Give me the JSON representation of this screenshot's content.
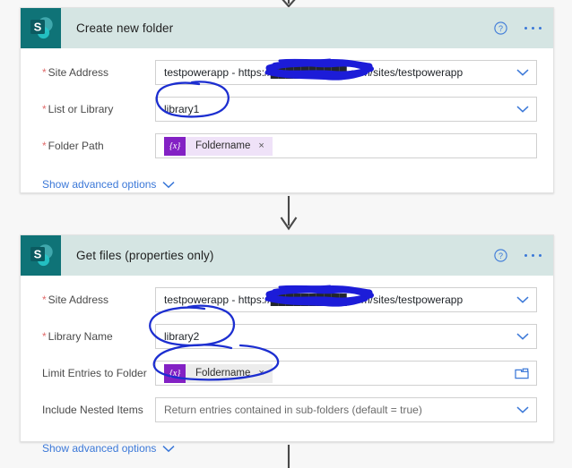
{
  "page": {
    "background": "#f7f7f7",
    "accent_blue": "#3b78d8",
    "sharepoint_teal": "#0f7377",
    "header_bar": "#d5e5e3",
    "annotation_ink": "#1c2ed0",
    "token_purple": "#8321c4"
  },
  "cards": [
    {
      "id": "create-new-folder",
      "title": "Create new folder",
      "icon": "sharepoint-icon",
      "help_icon": "help-circle-icon",
      "more_icon": "ellipsis-icon",
      "fields": [
        {
          "label": "Site Address",
          "required": true,
          "type": "dropdown",
          "value": "testpowerapp - https://██████████.com/sites/testpowerapp",
          "value_prefix": "testpowerapp - https://",
          "value_suffix": ".com/sites/testpowerapp",
          "redacted": true,
          "trailing_icon": "chevron-down-icon"
        },
        {
          "label": "List or Library",
          "required": true,
          "type": "dropdown",
          "value": "library1",
          "trailing_icon": "chevron-down-icon"
        },
        {
          "label": "Folder Path",
          "required": true,
          "type": "token",
          "token_badge": "{x}",
          "token_label": "Foldername",
          "token_remove": "×",
          "token_style": "lavender"
        }
      ],
      "advanced_label": "Show advanced options",
      "advanced_icon": "chevron-down-icon"
    },
    {
      "id": "get-files-properties-only",
      "title": "Get files (properties only)",
      "icon": "sharepoint-icon",
      "help_icon": "help-circle-icon",
      "more_icon": "ellipsis-icon",
      "fields": [
        {
          "label": "Site Address",
          "required": true,
          "type": "dropdown",
          "value": "testpowerapp - https://██████████.com/sites/testpowerapp",
          "value_prefix": "testpowerapp - https://",
          "value_suffix": ".com/sites/testpowerapp",
          "redacted": true,
          "trailing_icon": "chevron-down-icon"
        },
        {
          "label": "Library Name",
          "required": true,
          "type": "dropdown",
          "value": "library2",
          "trailing_icon": "chevron-down-icon"
        },
        {
          "label": "Limit Entries to Folder",
          "required": false,
          "type": "token",
          "token_badge": "{x}",
          "token_label": "Foldername",
          "token_remove": "×",
          "token_style": "grey",
          "trailing_icon": "folder-picker-icon"
        },
        {
          "label": "Include Nested Items",
          "required": false,
          "type": "dropdown",
          "value": "Return entries contained in sub-folders (default = true)",
          "muted": true,
          "trailing_icon": "chevron-down-icon"
        }
      ],
      "advanced_label": "Show advanced options",
      "advanced_icon": "chevron-down-icon"
    }
  ],
  "connectors": [
    {
      "name": "arrow-into-create-new-folder",
      "position": "top"
    },
    {
      "name": "arrow-create-to-getfiles",
      "position": "between"
    },
    {
      "name": "arrow-out-of-getfiles",
      "position": "bottom"
    }
  ],
  "annotations": [
    {
      "name": "circle-library1",
      "shape": "hand-drawn-ellipse",
      "targets": "library1"
    },
    {
      "name": "circle-library2",
      "shape": "hand-drawn-ellipse",
      "targets": "library2"
    },
    {
      "name": "circle-limit-entries-token",
      "shape": "hand-drawn-ellipse",
      "targets": "Foldername"
    },
    {
      "name": "scribble-redaction-site-address-1",
      "shape": "scribble",
      "targets": "tenant domain"
    },
    {
      "name": "scribble-redaction-site-address-2",
      "shape": "scribble",
      "targets": "tenant domain"
    }
  ]
}
